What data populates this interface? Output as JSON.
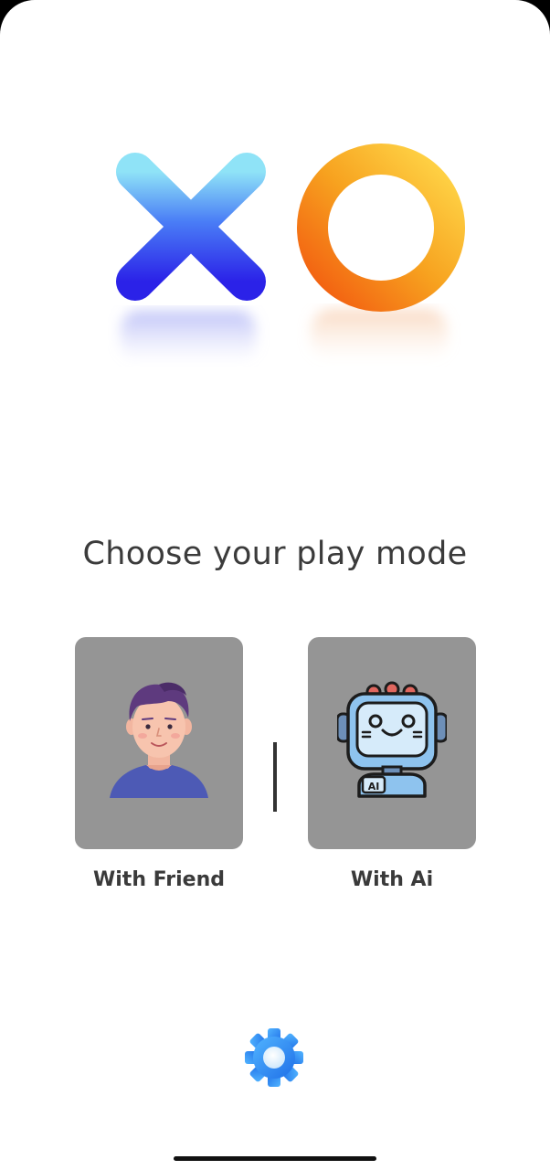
{
  "logo": {
    "x_icon": "x-mark-icon",
    "o_icon": "o-ring-icon",
    "x_colors": [
      "#8fe3f7",
      "#4a63f5",
      "#2b22e8"
    ],
    "o_colors": [
      "#ffd84a",
      "#f7a21f",
      "#f25a10"
    ]
  },
  "title": "Choose your play mode",
  "modes": [
    {
      "label": "With Friend",
      "icon": "person-avatar-icon"
    },
    {
      "label": "With Ai",
      "icon": "robot-avatar-icon",
      "badge": "AI"
    }
  ],
  "settings": {
    "icon": "gear-icon"
  },
  "colors": {
    "background": "#ffffff",
    "card": "#959595",
    "text": "#3b3b3b",
    "settings_blue": "#2f8ff7"
  }
}
